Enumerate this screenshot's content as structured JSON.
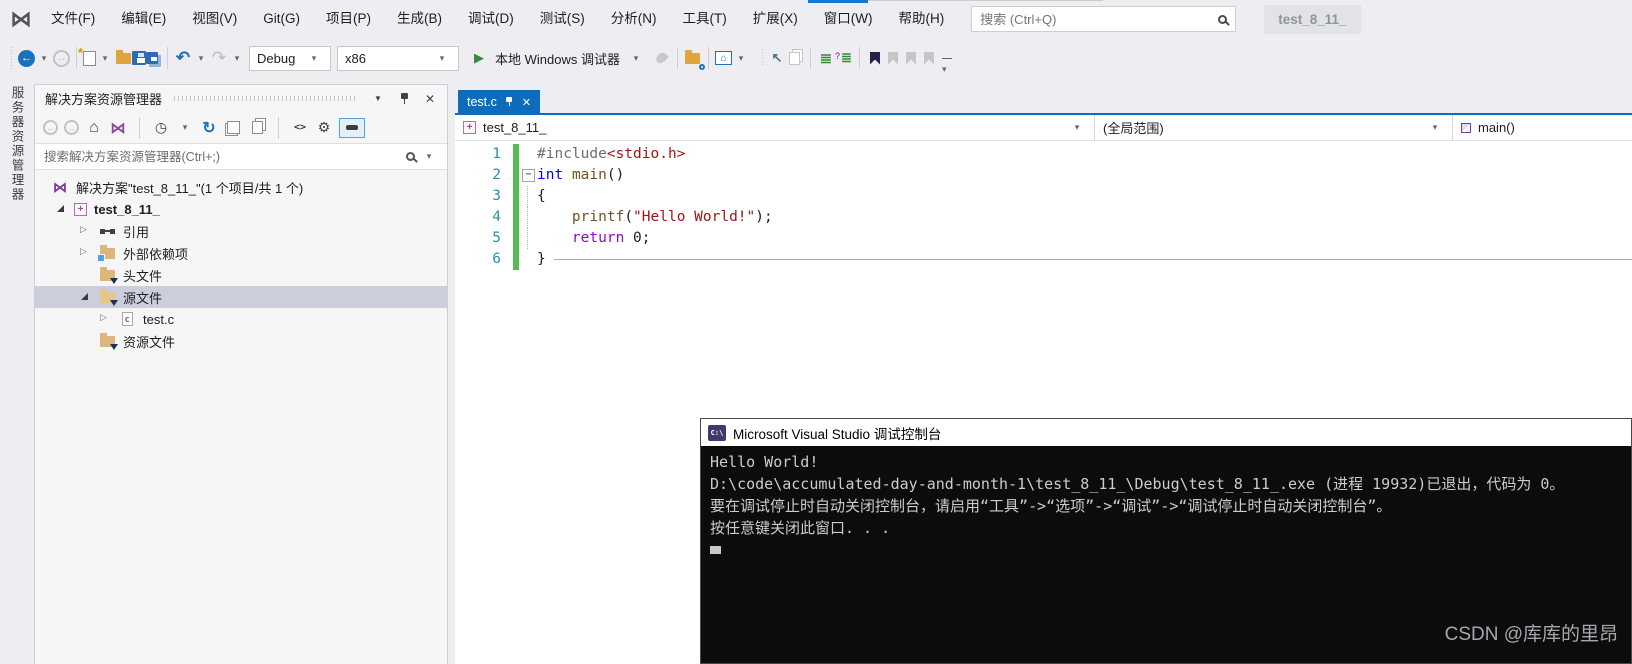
{
  "window": {
    "title_chip": "test_8_11_"
  },
  "menu": {
    "items": [
      "文件(F)",
      "编辑(E)",
      "视图(V)",
      "Git(G)",
      "项目(P)",
      "生成(B)",
      "调试(D)",
      "测试(S)",
      "分析(N)",
      "工具(T)",
      "扩展(X)",
      "窗口(W)",
      "帮助(H)"
    ],
    "search_placeholder": "搜索 (Ctrl+Q)"
  },
  "toolbar": {
    "config": "Debug",
    "platform": "x86",
    "run_label": "本地 Windows 调试器"
  },
  "activity_bar": {
    "vertical_label": "服务器资源管理器"
  },
  "solution_explorer": {
    "title": "解决方案资源管理器",
    "search_placeholder": "搜索解决方案资源管理器(Ctrl+;)",
    "tree": [
      {
        "label": "解决方案\"test_8_11_\"(1 个项目/共 1 个)"
      },
      {
        "label": "test_8_11_"
      },
      {
        "label": "引用"
      },
      {
        "label": "外部依赖项"
      },
      {
        "label": "头文件"
      },
      {
        "label": "源文件"
      },
      {
        "label": "test.c"
      },
      {
        "label": "资源文件"
      }
    ]
  },
  "editor": {
    "tab": "test.c",
    "nav": {
      "project": "test_8_11_",
      "scope": "(全局范围)",
      "member": "main()"
    },
    "code": {
      "lines": [
        {
          "num": "1",
          "tokens": [
            {
              "t": "#include",
              "c": "pp"
            },
            {
              "t": "<stdio.h>",
              "c": "str"
            }
          ]
        },
        {
          "num": "2",
          "fold": true,
          "tokens": [
            {
              "t": "int",
              "c": "kw"
            },
            {
              "t": " ",
              "c": "pl"
            },
            {
              "t": "main",
              "c": "fn"
            },
            {
              "t": "()",
              "c": "pl"
            }
          ]
        },
        {
          "num": "3",
          "guide": true,
          "tokens": [
            {
              "t": "{",
              "c": "pl"
            }
          ]
        },
        {
          "num": "4",
          "guide": true,
          "tokens": [
            {
              "t": "    ",
              "c": "pl"
            },
            {
              "t": "printf",
              "c": "fn"
            },
            {
              "t": "(",
              "c": "pl"
            },
            {
              "t": "\"Hello World!\"",
              "c": "str"
            },
            {
              "t": ")",
              "c": "pl"
            },
            {
              "t": ";",
              "c": "pl"
            }
          ]
        },
        {
          "num": "5",
          "guide": true,
          "tokens": [
            {
              "t": "    ",
              "c": "pl"
            },
            {
              "t": "return",
              "c": "ctrl"
            },
            {
              "t": " 0",
              "c": "pl"
            },
            {
              "t": ";",
              "c": "pl"
            }
          ]
        },
        {
          "num": "6",
          "endline": true,
          "tokens": [
            {
              "t": "}",
              "c": "pl"
            }
          ]
        }
      ]
    }
  },
  "console": {
    "title": "Microsoft Visual Studio 调试控制台",
    "icon_text": "C:\\",
    "lines": [
      "Hello World!",
      "D:\\code\\accumulated-day-and-month-1\\test_8_11_\\Debug\\test_8_11_.exe (进程 19932)已退出，代码为 0。",
      "要在调试停止时自动关闭控制台，请启用“工具”->“选项”->“调试”->“调试停止时自动关闭控制台”。",
      "按任意键关闭此窗口. . ."
    ]
  },
  "watermark": "CSDN @库库的里昂",
  "colors": {
    "accent": "#0F6CBD",
    "selection": "#CCCEDB",
    "console_bg": "#0C0C0C",
    "change_bar": "#57BB54",
    "line_number": "#2B91AF"
  }
}
